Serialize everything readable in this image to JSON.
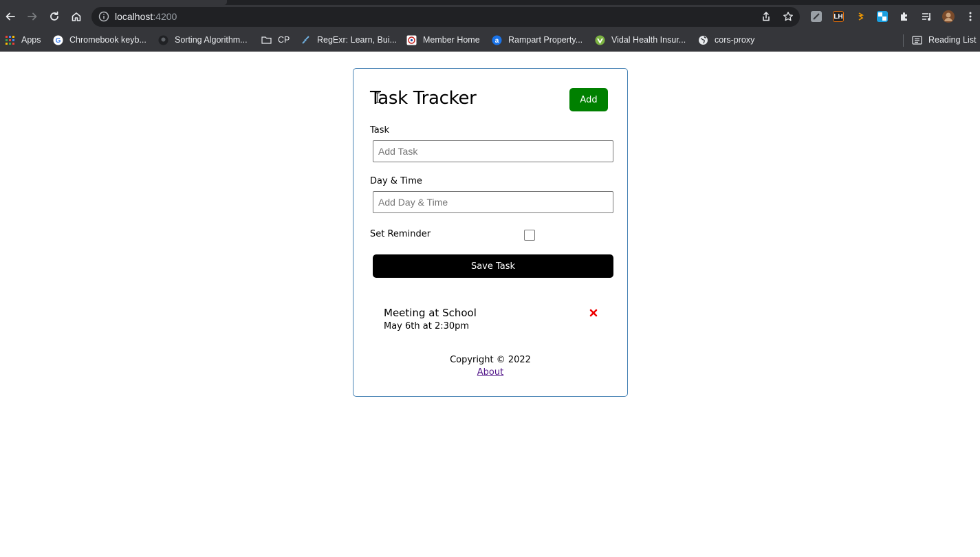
{
  "browser": {
    "url_host": "localhost",
    "url_port": ":4200",
    "bookmarks": [
      {
        "label": "Apps",
        "icon": "apps-grid-icon"
      },
      {
        "label": "Chromebook keyb...",
        "icon": "google-icon"
      },
      {
        "label": "Sorting Algorithm...",
        "icon": "github-icon"
      },
      {
        "label": "CP",
        "icon": "folder-icon"
      },
      {
        "label": "RegExr: Learn, Bui...",
        "icon": "regexr-icon"
      },
      {
        "label": "Member Home",
        "icon": "member-icon"
      },
      {
        "label": "Rampart Property...",
        "icon": "rampart-icon"
      },
      {
        "label": "Vidal Health Insur...",
        "icon": "vidal-icon"
      },
      {
        "label": "cors-proxy",
        "icon": "globe-icon"
      }
    ],
    "reading_list": "Reading List",
    "ext_lh_label": "LH"
  },
  "app": {
    "title": "Task Tracker",
    "add_label": "Add",
    "task_label": "Task",
    "task_placeholder": "Add Task",
    "day_label": "Day & Time",
    "day_placeholder": "Add Day & Time",
    "reminder_label": "Set Reminder",
    "reminder_checked": false,
    "save_label": "Save Task",
    "tasks": [
      {
        "text": "Meeting at School",
        "day": "May 6th at 2:30pm"
      }
    ],
    "copyright": "Copyright © 2022",
    "about_label": "About"
  },
  "colors": {
    "add_button": "#008000",
    "border": "#4682b4",
    "delete": "#ee0000"
  }
}
